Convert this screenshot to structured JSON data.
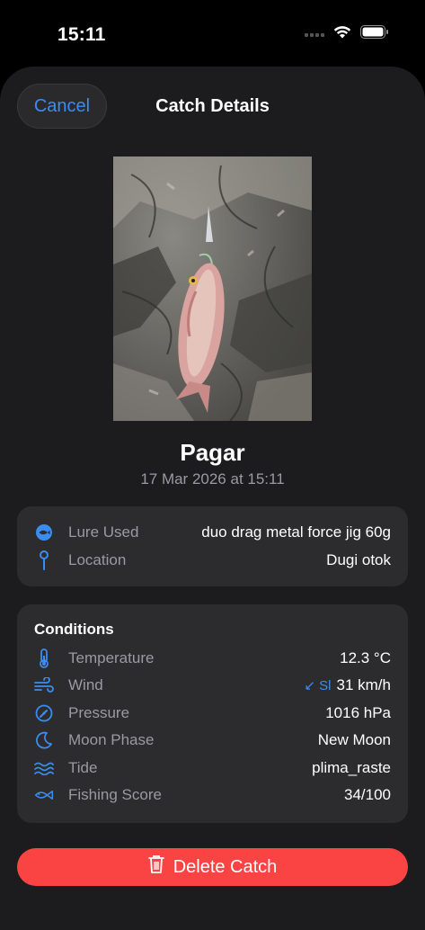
{
  "status": {
    "time": "15:11"
  },
  "header": {
    "cancel_label": "Cancel",
    "title": "Catch Details"
  },
  "catch": {
    "species": "Pagar",
    "date": "17 Mar 2026 at 15:11"
  },
  "info": {
    "lure_label": "Lure Used",
    "lure_value": "duo drag metal force jig 60g",
    "location_label": "Location",
    "location_value": "Dugi otok"
  },
  "conditions": {
    "title": "Conditions",
    "temperature_label": "Temperature",
    "temperature_value": "12.3 °C",
    "wind_label": "Wind",
    "wind_direction": "↙ Sl",
    "wind_value": "31 km/h",
    "pressure_label": "Pressure",
    "pressure_value": "1016 hPa",
    "moon_label": "Moon Phase",
    "moon_value": "New Moon",
    "tide_label": "Tide",
    "tide_value": "plima_raste",
    "score_label": "Fishing Score",
    "score_value": "34/100"
  },
  "actions": {
    "delete_label": "Delete Catch"
  },
  "colors": {
    "accent": "#3b8cf0",
    "danger": "#fa4444",
    "card": "#2c2c2e",
    "sheet": "#1c1c1e"
  }
}
